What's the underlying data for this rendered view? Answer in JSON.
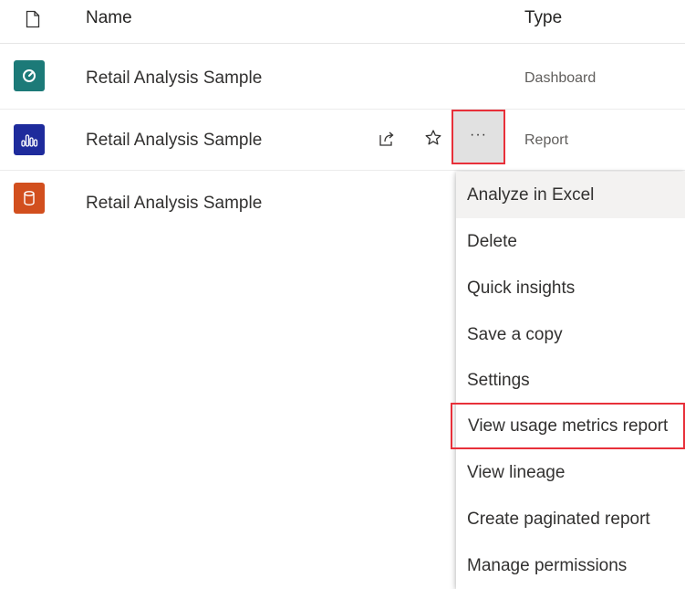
{
  "header": {
    "name_label": "Name",
    "type_label": "Type",
    "file_icon": "file-icon"
  },
  "rows": [
    {
      "name": "Retail Analysis Sample",
      "type": "Dashboard",
      "icon": "dashboard-icon",
      "color": "#1c7a78"
    },
    {
      "name": "Retail Analysis Sample",
      "type": "Report",
      "icon": "report-icon",
      "color": "#1e2b9c"
    },
    {
      "name": "Retail Analysis Sample",
      "type": "",
      "icon": "dataset-icon",
      "color": "#d24f1e"
    }
  ],
  "row_actions": {
    "share_icon": "share-icon",
    "favorite_icon": "star-icon",
    "more_label": "···"
  },
  "context_menu": {
    "items": [
      "Analyze in Excel",
      "Delete",
      "Quick insights",
      "Save a copy",
      "Settings",
      "View usage metrics report",
      "View lineage",
      "Create paginated report",
      "Manage permissions"
    ],
    "highlighted_item": "View usage metrics report"
  },
  "colors": {
    "highlight_border": "#e8303a",
    "menu_hover": "#f3f2f1"
  }
}
